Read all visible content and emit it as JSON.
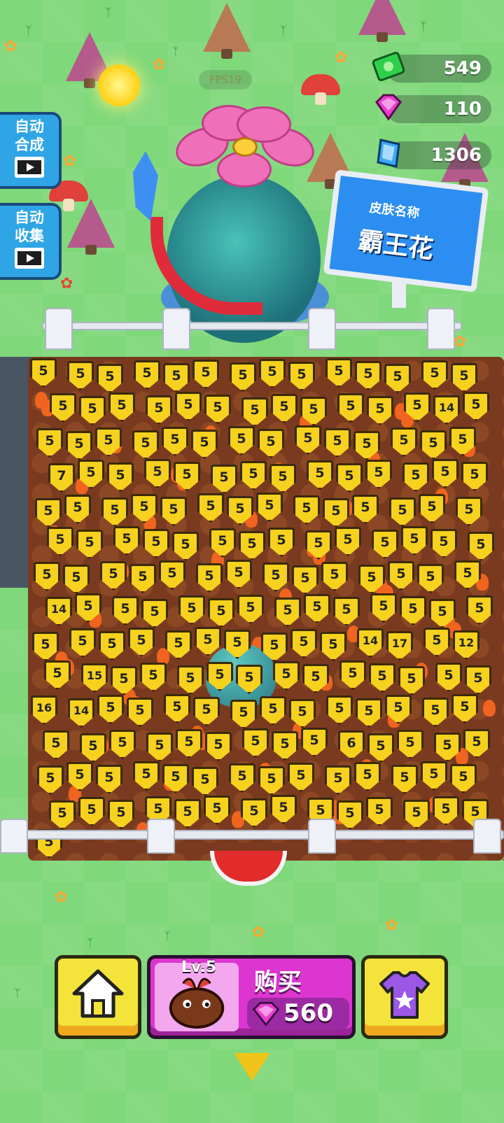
{
  "hud": {
    "fps_text": "FPS19",
    "currencies": [
      {
        "name": "cash",
        "value": "549",
        "color": "#2fcf4a",
        "icon": "cash-icon"
      },
      {
        "name": "gem_pink",
        "value": "110",
        "color": "#e83fcf",
        "icon": "pink-gem-icon"
      },
      {
        "name": "gem_blue",
        "value": "1306",
        "color": "#3aa8f3",
        "icon": "blue-crystal-icon"
      }
    ]
  },
  "side_buttons": [
    {
      "label": "自动合成",
      "icon": "video-ad-icon"
    },
    {
      "label": "自动收集",
      "icon": "video-ad-icon"
    }
  ],
  "sign": {
    "line1": "皮肤名称",
    "line2": "霸王花"
  },
  "units": [
    "5",
    "5",
    "5",
    "5",
    "5",
    "5",
    "5",
    "5",
    "5",
    "5",
    "5",
    "5",
    "5",
    "5",
    "5",
    "5",
    "5",
    "5",
    "5",
    "5",
    "5",
    "5",
    "5",
    "5",
    "5",
    "5",
    "14",
    "5",
    "5",
    "5",
    "5",
    "5",
    "5",
    "5",
    "5",
    "5",
    "5",
    "5",
    "5",
    "5",
    "5",
    "5",
    "7",
    "5",
    "5",
    "5",
    "5",
    "5",
    "5",
    "5",
    "5",
    "5",
    "5",
    "5",
    "5",
    "5",
    "5",
    "5",
    "5",
    "5",
    "5",
    "5",
    "5",
    "5",
    "5",
    "5",
    "5",
    "5",
    "5",
    "5",
    "5",
    "5",
    "5",
    "5",
    "5",
    "5",
    "5",
    "5",
    "5",
    "5",
    "5",
    "5",
    "5",
    "5",
    "5",
    "5",
    "5",
    "5",
    "5",
    "5",
    "5",
    "5",
    "5",
    "5",
    "5",
    "5",
    "5",
    "5",
    "14",
    "5",
    "5",
    "5",
    "5",
    "5",
    "5",
    "5",
    "5",
    "5",
    "5",
    "5",
    "5",
    "5",
    "5",
    "5",
    "5",
    "5",
    "5",
    "5",
    "5",
    "5",
    "5",
    "5",
    "14",
    "17",
    "5",
    "12",
    "5",
    "15",
    "5",
    "5",
    "5",
    "5",
    "5",
    "5",
    "5",
    "5",
    "5",
    "5",
    "5",
    "5",
    "16",
    "14",
    "5",
    "5",
    "5",
    "5",
    "5",
    "5",
    "5",
    "5",
    "5",
    "5",
    "5",
    "5",
    "5",
    "5",
    "5",
    "5",
    "5",
    "5",
    "5",
    "5",
    "5",
    "6",
    "5",
    "5",
    "5",
    "5",
    "5",
    "5",
    "5",
    "5",
    "5",
    "5",
    "5",
    "5",
    "5",
    "5",
    "5",
    "5",
    "5",
    "5",
    "5",
    "5",
    "5",
    "5",
    "5",
    "5",
    "5",
    "5",
    "5",
    "5",
    "5",
    "5",
    "5",
    "5",
    "5"
  ],
  "bottom_bar": {
    "home_icon": "home-icon",
    "buy": {
      "level": "Lv.5",
      "label": "购买",
      "price": "560",
      "price_icon": "pink-gem-icon"
    },
    "skin_icon": "shirt-icon"
  },
  "colors": {
    "grass": "#7fd87a",
    "badge": "#f6d11e",
    "buy_button": "#dd35d0",
    "yellow_button": "#f3e33a"
  }
}
